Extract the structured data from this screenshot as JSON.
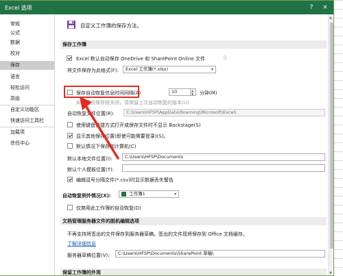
{
  "window": {
    "title": "Excel 选项",
    "help_icon": "?",
    "close_icon": "×"
  },
  "sidebar": {
    "items": [
      {
        "label": "常规"
      },
      {
        "label": "公式"
      },
      {
        "label": "数据"
      },
      {
        "label": "校对"
      },
      {
        "label": "保存"
      },
      {
        "label": "语言"
      },
      {
        "label": "轻松访问"
      },
      {
        "label": "高级"
      },
      {
        "label": "自定义功能区"
      },
      {
        "label": "快速访问工具栏"
      },
      {
        "label": "加载项"
      },
      {
        "label": "信任中心"
      }
    ],
    "active": "保存"
  },
  "header": {
    "text": "自定义工作簿的保存方法。"
  },
  "save_workbooks": {
    "section_title": "保存工作簿",
    "autosave_label": "Excel 默认自动保存 OneDrive 和 SharePoint Online 文件",
    "autosave_checked": true,
    "format_label": "将文件保存为此格式(F):",
    "format_value": "Excel 工作簿(*.xlsx)",
    "autorecover_label": "保存自动恢复信息时间间隔(A)",
    "autorecover_checked": false,
    "autorecover_minutes": "10",
    "minutes_unit": "分钟(M)",
    "keep_last_label": "如果我没保存就关闭，请保留上次自动恢复的版本(U)",
    "autorecover_location_label": "自动恢复文件位置(R):",
    "autorecover_location_value": "C:\\Users\\HFSP\\AppData\\Roaming\\Microsoft\\Excel\\",
    "no_backstage_label": "使用键盘快捷方式打开或保存文件时不显示 Backstage(S)",
    "no_backstage_checked": false,
    "show_more_places_label": "显示其他保存位置(即使可能需要登录)(S)。",
    "show_more_places_checked": true,
    "save_to_computer_label": "默认情况下保存到计算机(C)",
    "save_to_computer_checked": false,
    "local_location_label": "默认本地文件位置(I):",
    "local_location_value": "C:\\Users\\HFSP\\Documents",
    "personal_templates_label": "默认个人模板位置(T):",
    "personal_templates_value": "",
    "csv_warning_label": "编辑逗号分隔文件(*.csv)时显示数据丢失警告",
    "csv_warning_checked": true
  },
  "autorecover_exceptions": {
    "label": "自动恢复例外情况(X):",
    "workbook_value": "工作簿1",
    "disable_label": "仅禁用此工作簿的自动恢复(D)",
    "disable_checked": false
  },
  "offline_editing": {
    "section_title": "文档管理服务器文件的脱机编辑选项",
    "description": "不再支持将签出的文件保存到服务器草稿。签出的文件现将保存到 Office 文档缓存。",
    "learn_more": "了解详细信息",
    "drafts_label": "服务器草稿位置(V):",
    "drafts_value": "C:\\Users\\HFSP\\Documents\\SharePoint 草稿\\"
  },
  "preserve_visual": {
    "section_title": "保留工作簿的外观"
  },
  "colors": {
    "title_bar": "#217346",
    "highlight": "#e52a1e"
  }
}
